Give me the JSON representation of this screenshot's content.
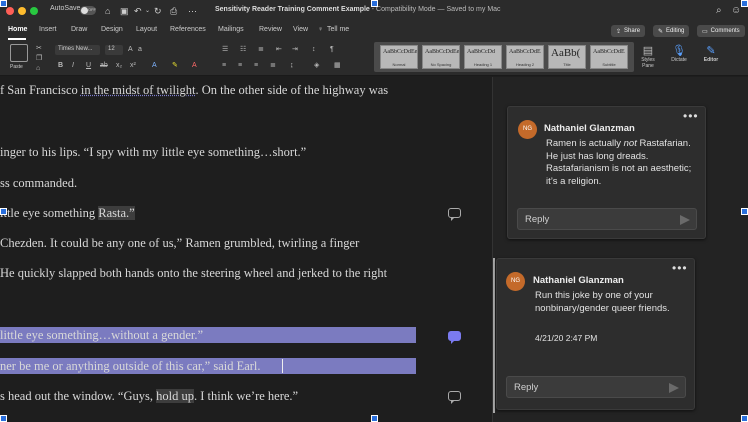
{
  "titlebar": {
    "autosave": "AutoSave",
    "toggle_state": "OFF",
    "document_title": "Sensitivity Reader Training Comment Example",
    "mode": " - Compatibility Mode",
    "saved": " — Saved to my Mac",
    "traffic_lights": [
      "#ff5f57",
      "#febc2e",
      "#28c840"
    ]
  },
  "ribbon_tabs": [
    "Home",
    "Insert",
    "Draw",
    "Design",
    "Layout",
    "References",
    "Mailings",
    "Review",
    "View",
    "Tell me"
  ],
  "ribbon_buttons": {
    "share": "Share",
    "editing": "Editing",
    "comments": "Comments"
  },
  "ribbon": {
    "paste": "Paste",
    "font": "Times New...",
    "size": "12",
    "styles": [
      {
        "preview": "AaBbCcDdEe",
        "name": "Normal"
      },
      {
        "preview": "AaBbCcDdEe",
        "name": "No Spacing"
      },
      {
        "preview": "AaBbCcDd",
        "name": "Heading 1"
      },
      {
        "preview": "AaBbCcDdE",
        "name": "Heading 2"
      },
      {
        "preview": "AaBb(",
        "name": "Title"
      },
      {
        "preview": "AaBbCcDdE",
        "name": "Subtitle"
      }
    ],
    "styles_pane": "Styles Pane",
    "dictate": "Dictate",
    "editor": "Editor"
  },
  "document": {
    "lines": [
      {
        "pre": "f San Francisco ",
        "mark": "in the midst of twilight",
        "post": ". On the other side of the highway was"
      },
      {
        "pre": "inger to his lips. “I spy with my little eye something…short.”"
      },
      {
        "pre": "ss commanded."
      },
      {
        "pre": "ittle eye something ",
        "box": "Rasta.”"
      },
      {
        "pre": "Chezden. It could be any one of us,” Ramen grumbled, twirling a finger"
      },
      {
        "pre": " He quickly slapped both hands onto the steering wheel and jerked to the right"
      },
      {
        "pre": " little eye something…without a gender.”"
      },
      {
        "pre": "ner be me or anything outside of this car,” said Earl."
      },
      {
        "pre": "s head out the window. “Guys, ",
        "box": "hold up",
        "post": ". I think we’re here.”"
      }
    ]
  },
  "comments": [
    {
      "initials": "NG",
      "author": "Nathaniel Glanzman",
      "text_pre": "Ramen is actually ",
      "text_em": "not",
      "text_post": " Rastafarian. He just has long dreads. Rastafarianism is not an aesthetic; it’s a religion.",
      "reply": "Reply"
    },
    {
      "initials": "NG",
      "author": "Nathaniel Glanzman",
      "text": "Run this joke by one of your nonbinary/gender queer friends.",
      "timestamp": "4/21/20 2:47 PM",
      "reply": "Reply"
    }
  ]
}
